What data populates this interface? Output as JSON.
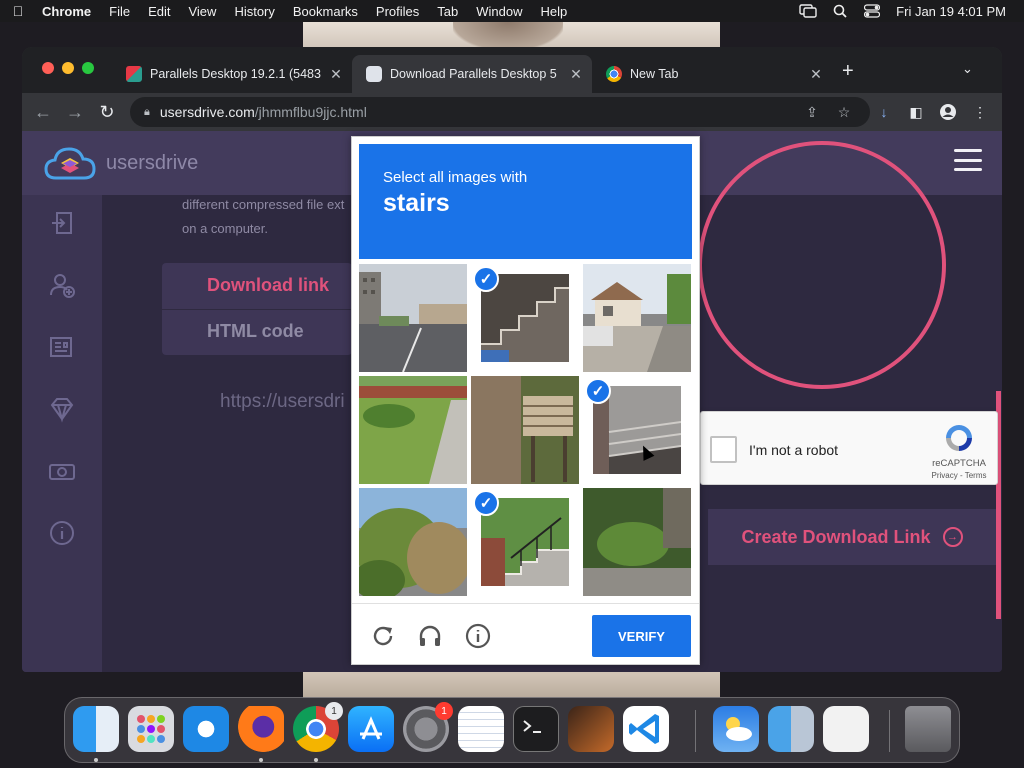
{
  "menubar": {
    "app_name": "Chrome",
    "menus": [
      "File",
      "Edit",
      "View",
      "History",
      "Bookmarks",
      "Profiles",
      "Tab",
      "Window",
      "Help"
    ],
    "clock": "Fri Jan 19  4:01 PM"
  },
  "browser": {
    "tabs": [
      {
        "title": "Parallels Desktop 19.2.1 (5483",
        "active": false
      },
      {
        "title": "Download Parallels Desktop 5",
        "active": true
      },
      {
        "title": "New Tab",
        "active": false
      }
    ],
    "url_domain": "usersdrive.com",
    "url_path": "/jhmmflbu9jjc.html"
  },
  "site": {
    "logo_text": "usersdrive",
    "description": "different compressed file ext on a computer.",
    "tab_download": "Download link",
    "tab_html": "HTML code",
    "url_field": "https://usersdri",
    "create_button": "Create Download Link",
    "accent_color": "#e0527c"
  },
  "recaptcha": {
    "checkbox_label": "I'm not a robot",
    "brand": "reCAPTCHA",
    "terms": "Privacy - Terms"
  },
  "challenge": {
    "instruction": "Select all images with",
    "object": "stairs",
    "verify_label": "VERIFY",
    "header_color": "#1a73e8",
    "tiles": [
      {
        "selected": false
      },
      {
        "selected": true
      },
      {
        "selected": false
      },
      {
        "selected": false
      },
      {
        "selected": false
      },
      {
        "selected": true
      },
      {
        "selected": false
      },
      {
        "selected": true
      },
      {
        "selected": false
      }
    ]
  },
  "dock": {
    "system_settings_badge": "1",
    "chrome_badge": "1"
  }
}
